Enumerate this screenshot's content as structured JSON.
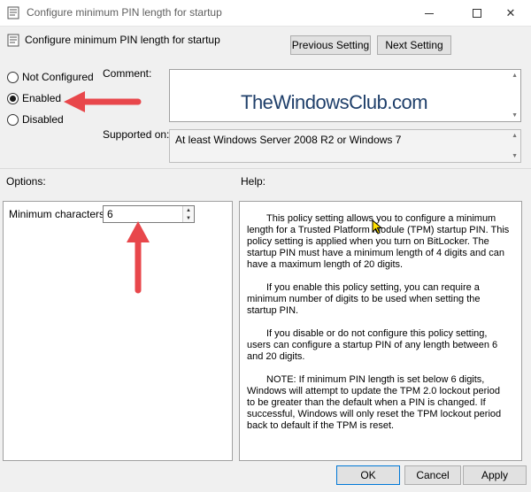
{
  "window": {
    "title": "Configure minimum PIN length for startup"
  },
  "header": {
    "policy_title": "Configure minimum PIN length for startup",
    "prev_label": "Previous Setting",
    "next_label": "Next Setting"
  },
  "state": {
    "options": [
      {
        "label": "Not Configured",
        "checked": false
      },
      {
        "label": "Enabled",
        "checked": true
      },
      {
        "label": "Disabled",
        "checked": false
      }
    ]
  },
  "comment": {
    "label": "Comment:",
    "watermark": "TheWindowsClub.com"
  },
  "supported": {
    "label": "Supported on:",
    "value": "At least Windows Server 2008 R2 or Windows 7"
  },
  "options_panel": {
    "heading": "Options:",
    "min_chars_label": "Minimum characters:",
    "min_chars_value": "6"
  },
  "help_panel": {
    "heading": "Help:",
    "paragraphs": [
      "This policy setting allows you to configure a minimum length for a Trusted Platform Module (TPM) startup PIN. This policy setting is applied when you turn on BitLocker. The startup PIN must have a minimum length of 4 digits and can have a maximum length of 20 digits.",
      "If you enable this policy setting, you can require a minimum number of digits to be used when setting the startup PIN.",
      "If you disable or do not configure this policy setting, users can configure a startup PIN of any length between 6 and 20 digits.",
      "NOTE: If minimum PIN length is set below 6 digits, Windows will attempt to update the TPM 2.0 lockout period to be greater than the default when a PIN is changed. If successful, Windows will only reset the TPM lockout period back to default if the TPM is reset."
    ]
  },
  "footer": {
    "ok_label": "OK",
    "cancel_label": "Cancel",
    "apply_label": "Apply"
  },
  "colors": {
    "annotation_arrow": "#e8474b",
    "watermark_text": "#1f3f6a",
    "ok_border": "#0078d7"
  }
}
